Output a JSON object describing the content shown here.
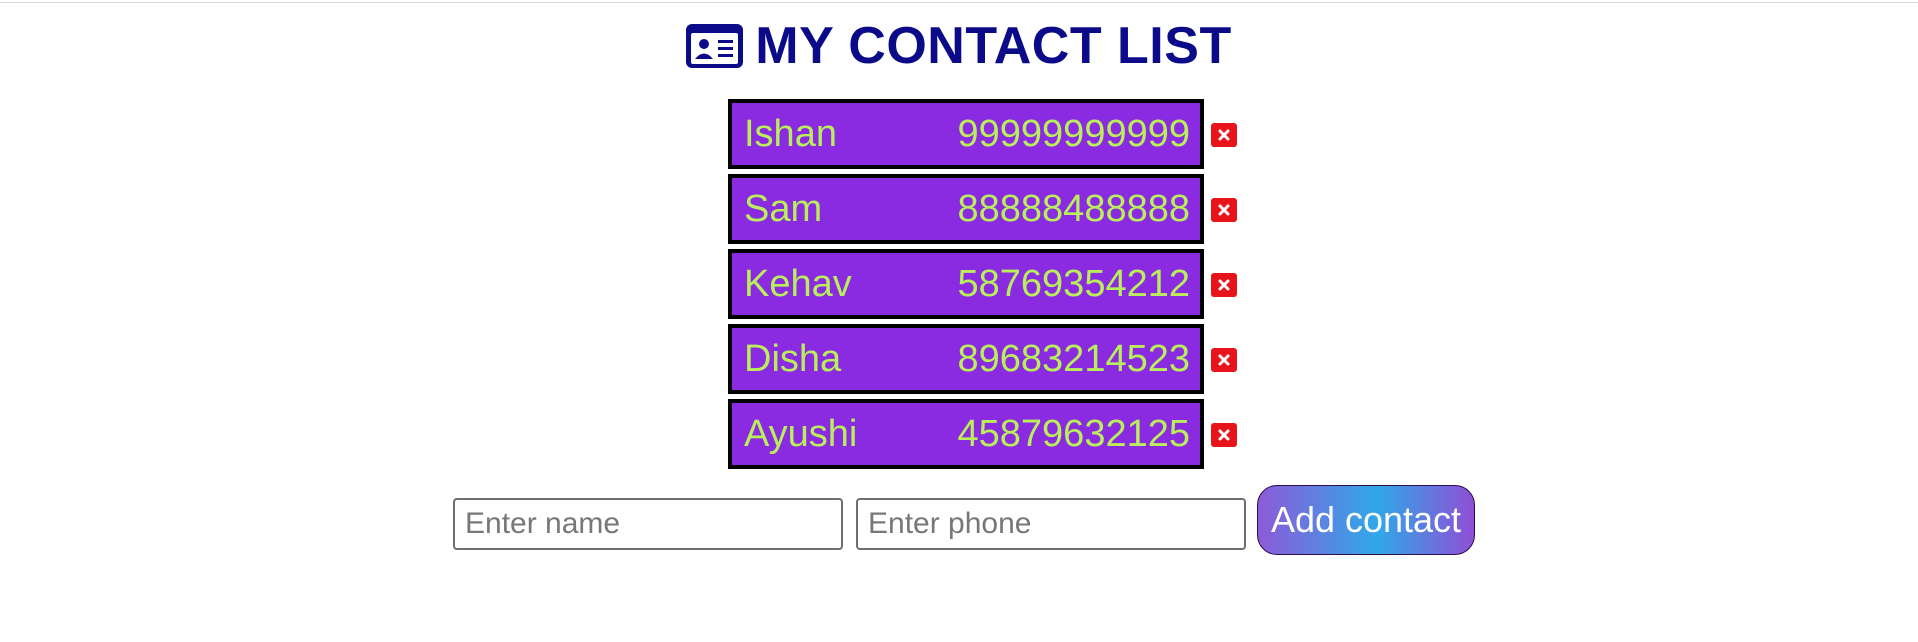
{
  "header": {
    "title": "MY CONTACT LIST",
    "icon": "contact-card-icon",
    "title_color": "#0b0b8a"
  },
  "contacts": [
    {
      "name": "Ishan",
      "phone": "99999999999"
    },
    {
      "name": "Sam",
      "phone": "88888488888"
    },
    {
      "name": "Kehav",
      "phone": "58769354212"
    },
    {
      "name": "Disha",
      "phone": "89683214523"
    },
    {
      "name": "Ayushi",
      "phone": "45879632125"
    }
  ],
  "form": {
    "name_placeholder": "Enter name",
    "name_value": "",
    "phone_placeholder": "Enter phone",
    "phone_value": "",
    "add_button_label": "Add contact"
  },
  "colors": {
    "card_bg": "#8a2be2",
    "card_text": "#b9ef5a",
    "delete_button": "#e8141b"
  },
  "icons": {
    "delete": "close-icon"
  }
}
